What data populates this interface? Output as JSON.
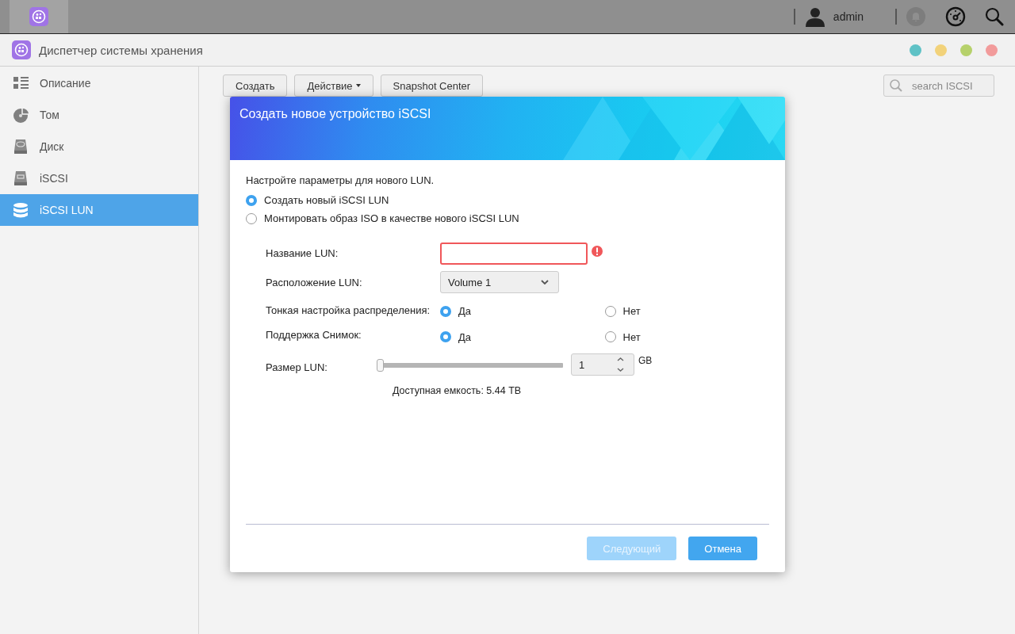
{
  "taskbar": {
    "user": "admin"
  },
  "window": {
    "title": "Диспетчер системы хранения",
    "controls": [
      {
        "color": "#5fc2c6"
      },
      {
        "color": "#f2d27a"
      },
      {
        "color": "#b6d16b"
      },
      {
        "color": "#f29b9b"
      }
    ]
  },
  "sidebar": {
    "items": [
      {
        "label": "Описание",
        "kind": "overview",
        "selected": false
      },
      {
        "label": "Том",
        "kind": "volume",
        "selected": false
      },
      {
        "label": "Диск",
        "kind": "disk",
        "selected": false
      },
      {
        "label": "iSCSI",
        "kind": "iscsi",
        "selected": false
      },
      {
        "label": "iSCSI LUN",
        "kind": "lun",
        "selected": true
      }
    ]
  },
  "toolbar": {
    "buttons": [
      {
        "label": "Создать",
        "kind": "button"
      },
      {
        "label": "Действие",
        "kind": "dropdown"
      },
      {
        "label": "Snapshot Center",
        "kind": "button"
      }
    ],
    "search": {
      "placeholder": "search ISCSI"
    }
  },
  "dialog": {
    "title": "Создать новое устройство iSCSI",
    "intro": "Настройте параметры для нового LUN.",
    "modes": [
      {
        "label": "Создать новый iSCSI LUN",
        "selected": true
      },
      {
        "label": "Монтировать образ ISO в качестве нового iSCSI LUN",
        "selected": false
      }
    ],
    "name": {
      "label": "Название LUN:",
      "invalid": true
    },
    "location": {
      "label": "Расположение LUN:",
      "value": "Volume 1"
    },
    "thin": {
      "label": "Тонкая настройка распределения:",
      "options": [
        {
          "label": "Да",
          "selected": true
        },
        {
          "label": "Нет",
          "selected": false
        }
      ]
    },
    "snapshot": {
      "label": "Поддержка Снимок:",
      "options": [
        {
          "label": "Да",
          "selected": true
        },
        {
          "label": "Нет",
          "selected": false
        }
      ]
    },
    "size": {
      "label": "Размер LUN:",
      "level": 0,
      "value": "1",
      "unit": "GB"
    },
    "capacity": "Доступная емкость: 5.44 TB",
    "buttons": [
      {
        "label": "Следующий",
        "disabled": true
      },
      {
        "label": "Отмена",
        "disabled": false
      }
    ]
  }
}
